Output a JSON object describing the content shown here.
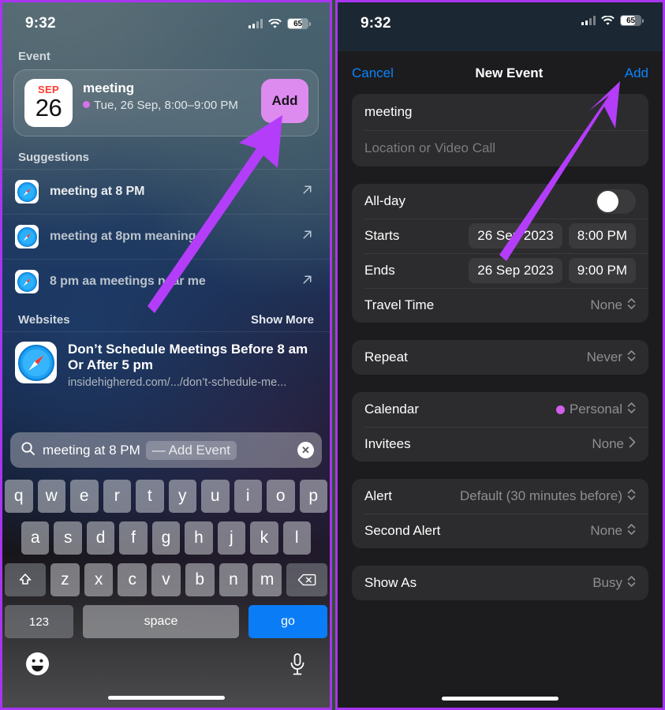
{
  "status_bar": {
    "time": "9:32",
    "battery_percent": "65",
    "cellular_icon": "cellular-bars-icon",
    "wifi_icon": "wifi-icon",
    "battery_icon": "battery-icon"
  },
  "left_panel": {
    "event_section": {
      "header": "Event",
      "date_badge": {
        "month": "SEP",
        "day": "26"
      },
      "title": "meeting",
      "subtitle": "Tue, 26 Sep, 8:00–9:00 PM",
      "add_button": "Add",
      "add_button_color": "#dd8bee",
      "dot_color": "#d771e8"
    },
    "suggestions_section": {
      "header": "Suggestions",
      "items": [
        {
          "label": "meeting at 8 PM",
          "icon": "safari-icon",
          "action_icon": "arrow-up-right-icon"
        },
        {
          "label": "meeting at 8pm meaning",
          "icon": "safari-icon",
          "action_icon": "arrow-up-right-icon"
        },
        {
          "label": "8 pm aa meetings near me",
          "icon": "safari-icon",
          "action_icon": "arrow-up-right-icon"
        }
      ]
    },
    "websites_section": {
      "header": "Websites",
      "show_more": "Show More",
      "result": {
        "icon": "safari-icon",
        "title": "Don’t Schedule Meetings Before 8 am Or After 5 pm",
        "url": "insidehighered.com/.../don’t-schedule-me..."
      }
    },
    "search_bar": {
      "search_icon": "magnifier-icon",
      "value": "meeting at 8 PM",
      "token_separator": "—",
      "token": "Add Event",
      "clear_icon": "clear-x-icon"
    },
    "keyboard": {
      "row1": [
        "q",
        "w",
        "e",
        "r",
        "t",
        "y",
        "u",
        "i",
        "o",
        "p"
      ],
      "row2": [
        "a",
        "s",
        "d",
        "f",
        "g",
        "h",
        "j",
        "k",
        "l"
      ],
      "row3_shift": "shift-icon",
      "row3": [
        "z",
        "x",
        "c",
        "v",
        "b",
        "n",
        "m"
      ],
      "row3_delete": "backspace-icon",
      "numbers_key": "123",
      "space_key": "space",
      "return_key": "go",
      "emoji_icon": "emoji-smiley-icon",
      "mic_icon": "microphone-icon"
    }
  },
  "right_panel": {
    "nav": {
      "cancel": "Cancel",
      "title": "New Event",
      "add": "Add",
      "accent_color": "#0a84ff"
    },
    "title_field": {
      "value": "meeting"
    },
    "location_field": {
      "placeholder": "Location or Video Call"
    },
    "schedule": {
      "all_day": {
        "label": "All-day",
        "enabled": false
      },
      "starts": {
        "label": "Starts",
        "date": "26 Sep 2023",
        "time": "8:00 PM"
      },
      "ends": {
        "label": "Ends",
        "date": "26 Sep 2023",
        "time": "9:00 PM"
      },
      "travel_time": {
        "label": "Travel Time",
        "value": "None",
        "chevron": "chevron-up-down-icon"
      }
    },
    "repeat": {
      "label": "Repeat",
      "value": "Never",
      "chevron": "chevron-up-down-icon"
    },
    "calendar": {
      "label": "Calendar",
      "value": "Personal",
      "dot_color": "#d060e8",
      "chevron": "chevron-up-down-icon"
    },
    "invitees": {
      "label": "Invitees",
      "value": "None",
      "chevron": "chevron-right-icon"
    },
    "alert": {
      "label": "Alert",
      "value": "Default (30 minutes before)",
      "chevron": "chevron-up-down-icon"
    },
    "second_alert": {
      "label": "Second Alert",
      "value": "None",
      "chevron": "chevron-up-down-icon"
    },
    "show_as": {
      "label": "Show As",
      "value": "Busy",
      "chevron": "chevron-up-down-icon"
    }
  },
  "annotations": {
    "arrow_color": "#b43dfa",
    "left_arrow": "points-to-add-button-in-event-card",
    "right_arrow": "points-to-add-button-in-navbar"
  }
}
